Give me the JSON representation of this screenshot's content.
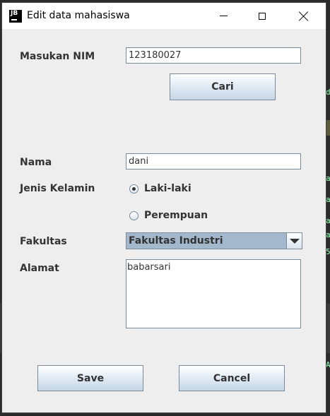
{
  "window": {
    "title": "Edit data mahasiswa",
    "icon_text": "JB"
  },
  "form": {
    "nim_label": "Masukan NIM",
    "nim_value": "123180027",
    "search_button": "Cari",
    "nama_label": "Nama",
    "nama_value": "dani",
    "gender_label": "Jenis Kelamin",
    "gender_options": [
      {
        "label": "Laki-laki",
        "selected": true
      },
      {
        "label": "Perempuan",
        "selected": false
      }
    ],
    "fakultas_label": "Fakultas",
    "fakultas_selected": "Fakultas Industri",
    "alamat_label": "Alamat",
    "alamat_value": "babarsari",
    "save_button": "Save",
    "cancel_button": "Cancel"
  },
  "background": {
    "fragments": [
      "d",
      "a",
      "a",
      "a",
      "a",
      "5",
      "A"
    ]
  }
}
